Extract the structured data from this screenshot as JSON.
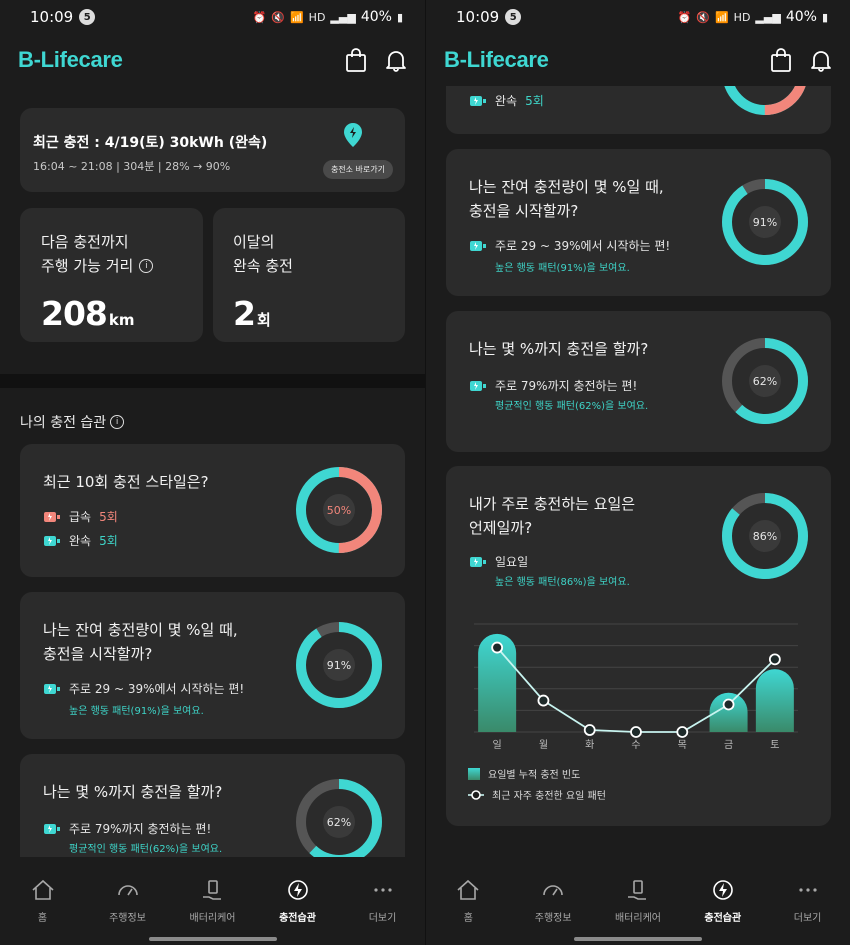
{
  "status": {
    "time": "10:09",
    "notif_count": "5",
    "battery": "40%",
    "network": "HD"
  },
  "app": {
    "logo": "B-Lifecare"
  },
  "recent_charge": {
    "title": "최근 충전 : 4/19(토) 30kWh (완속)",
    "detail": "16:04 ~ 21:08 | 304분 | 28% → 90%",
    "station_button": "충전소 바로가기"
  },
  "range": {
    "label_line1": "다음 충전까지",
    "label_line2": "주행 가능 거리",
    "value": "208",
    "unit": "km"
  },
  "slow_count": {
    "label_line1": "이달의",
    "label_line2": "완속 충전",
    "value": "2",
    "unit": "회"
  },
  "section": {
    "title": "나의 충전 습관"
  },
  "style_card": {
    "title": "최근 10회 충전 스타일은?",
    "fast_label": "급속",
    "fast_value": "5회",
    "slow_label": "완속",
    "slow_value": "5회",
    "donut_label": "50%",
    "fraction": 0.5
  },
  "start_card": {
    "title_line1": "나는 잔여 충전량이 몇 %일 때,",
    "title_line2": "충전을 시작할까?",
    "result": "주로 29 ~ 39%에서 시작하는 편!",
    "note": "높은 행동 패턴(91%)을 보여요.",
    "donut_label": "91%",
    "fraction": 0.91
  },
  "end_card": {
    "title": "나는 몇 %까지 충전을 할까?",
    "result": "주로 79%까지 충전하는 편!",
    "note": "평균적인 행동 패턴(62%)을 보여요.",
    "donut_label": "62%",
    "fraction": 0.62
  },
  "day_card": {
    "title_line1": "내가 주로 충전하는 요일은",
    "title_line2": "언제일까?",
    "result": "일요일",
    "note": "높은 행동 패턴(86%)을 보여요.",
    "donut_label": "86%",
    "fraction": 0.86
  },
  "right_top_partial": {
    "slow_label": "완속",
    "slow_value": "5회"
  },
  "chart_data": {
    "type": "bar",
    "categories": [
      "일",
      "월",
      "화",
      "수",
      "목",
      "금",
      "토"
    ],
    "series": [
      {
        "name": "요일별 누적 충전 빈도",
        "type": "bar",
        "values": [
          5,
          0,
          0,
          0,
          0,
          2,
          3.2
        ]
      },
      {
        "name": "최근 자주 충전한 요일 패턴",
        "type": "line",
        "values": [
          4.3,
          1.6,
          0.1,
          0,
          0,
          1.4,
          3.7
        ]
      }
    ],
    "ylim": [
      0,
      5.5
    ],
    "grid": true,
    "legend_position": "bottom-left",
    "colors": {
      "bar_top": "#3fd7d2",
      "bar_bottom": "#3a8a6a",
      "line": "#c8f4f0"
    }
  },
  "nav": {
    "items": [
      {
        "label": "홈",
        "icon": "home-icon"
      },
      {
        "label": "주행정보",
        "icon": "speedometer-icon"
      },
      {
        "label": "배터리케어",
        "icon": "battery-hand-icon"
      },
      {
        "label": "충전습관",
        "icon": "charging-bolt-icon"
      },
      {
        "label": "더보기",
        "icon": "more-dots-icon"
      }
    ],
    "active": "충전습관"
  },
  "colors": {
    "accent": "#3fd7d2",
    "salmon": "#f2867b",
    "card": "#2b2b2b",
    "bg": "#1c1c1c"
  }
}
